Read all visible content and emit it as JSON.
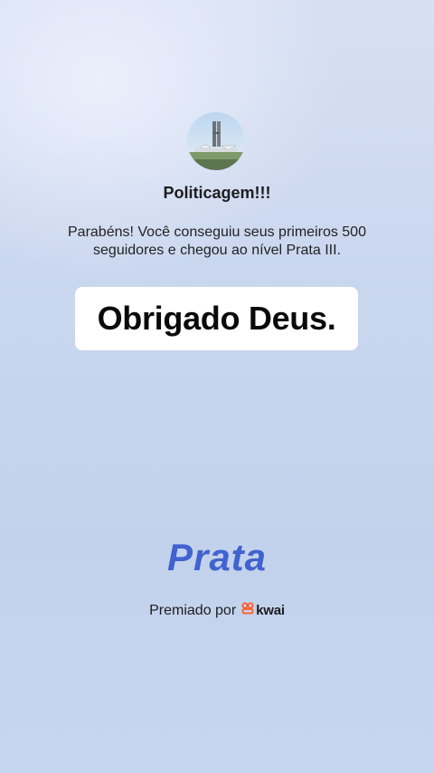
{
  "profile": {
    "avatar_icon": "congress-building-icon",
    "channel_name": "Politicagem!!!"
  },
  "message": {
    "line1": "Parabéns! Você conseguiu seus primeiros 500",
    "line2": "seguidores e chegou ao nível Prata III."
  },
  "caption": {
    "text": "Obrigado Deus."
  },
  "level": {
    "title": "Prata",
    "color": "#4162cf"
  },
  "footer": {
    "awarded_label": "Premiado por",
    "brand_icon": "kwai-logo-icon",
    "brand_name": "kwai",
    "brand_color": "#ff5a1f"
  }
}
